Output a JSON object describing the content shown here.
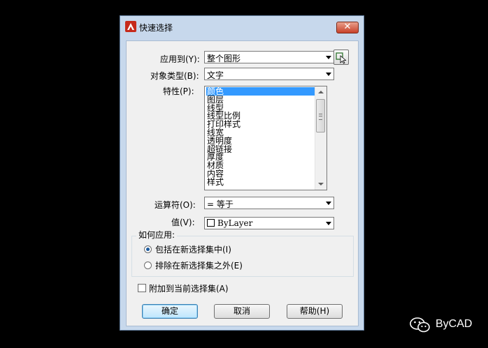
{
  "dialog": {
    "title": "快速选择",
    "close_label": "✕"
  },
  "form": {
    "apply_to": {
      "label": "应用到(Y):",
      "value": "整个图形"
    },
    "object_type": {
      "label": "对象类型(B):",
      "value": "文字"
    },
    "properties": {
      "label": "特性(P):",
      "items": [
        "颜色",
        "图层",
        "线型",
        "线型比例",
        "打印样式",
        "线宽",
        "透明度",
        "超链接",
        "厚度",
        "材质",
        "内容",
        "样式"
      ],
      "selected_index": 0
    },
    "operator": {
      "label": "运算符(O):",
      "value": "= 等于"
    },
    "value": {
      "label": "值(V):",
      "value": "ByLayer"
    }
  },
  "how_to_apply": {
    "legend": "如何应用:",
    "options": [
      {
        "label": "包括在新选择集中(I)",
        "checked": true
      },
      {
        "label": "排除在新选择集之外(E)",
        "checked": false
      }
    ]
  },
  "append": {
    "label": "附加到当前选择集(A)",
    "checked": false
  },
  "buttons": {
    "ok": "确定",
    "cancel": "取消",
    "help": "帮助(H)"
  },
  "watermark": {
    "text": "ByCAD"
  },
  "colors": {
    "selection": "#3399ff",
    "close_button": "#c8412a",
    "frame": "#c7d8ec"
  }
}
